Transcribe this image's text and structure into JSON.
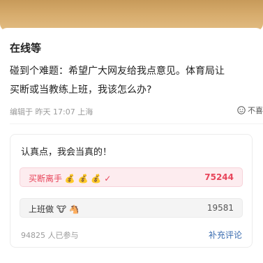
{
  "post": {
    "title": "在线等",
    "body_line1": "碰到个难题：希望广大网友给我点意见。体育局让",
    "body_line2": "买断或当教练上班，我该怎么办?",
    "meta": "编辑于 昨天 17:07 上海",
    "reaction_label": "不喜"
  },
  "poll": {
    "title": "认真点，我会当真的！",
    "options": [
      {
        "label": "买断离手 💰 💰 💰",
        "check": "✓",
        "count": "75244"
      },
      {
        "label": "上班做 🐮 🐴",
        "count": "19581"
      }
    ],
    "participants": "94825 人已参与",
    "supplement_link": "补充评论"
  },
  "colors": {
    "banner": "#d6ab6c",
    "accent_red": "#e8455b",
    "link_blue": "#3b6db0"
  },
  "icons": {
    "reaction": "smile-face-icon"
  }
}
